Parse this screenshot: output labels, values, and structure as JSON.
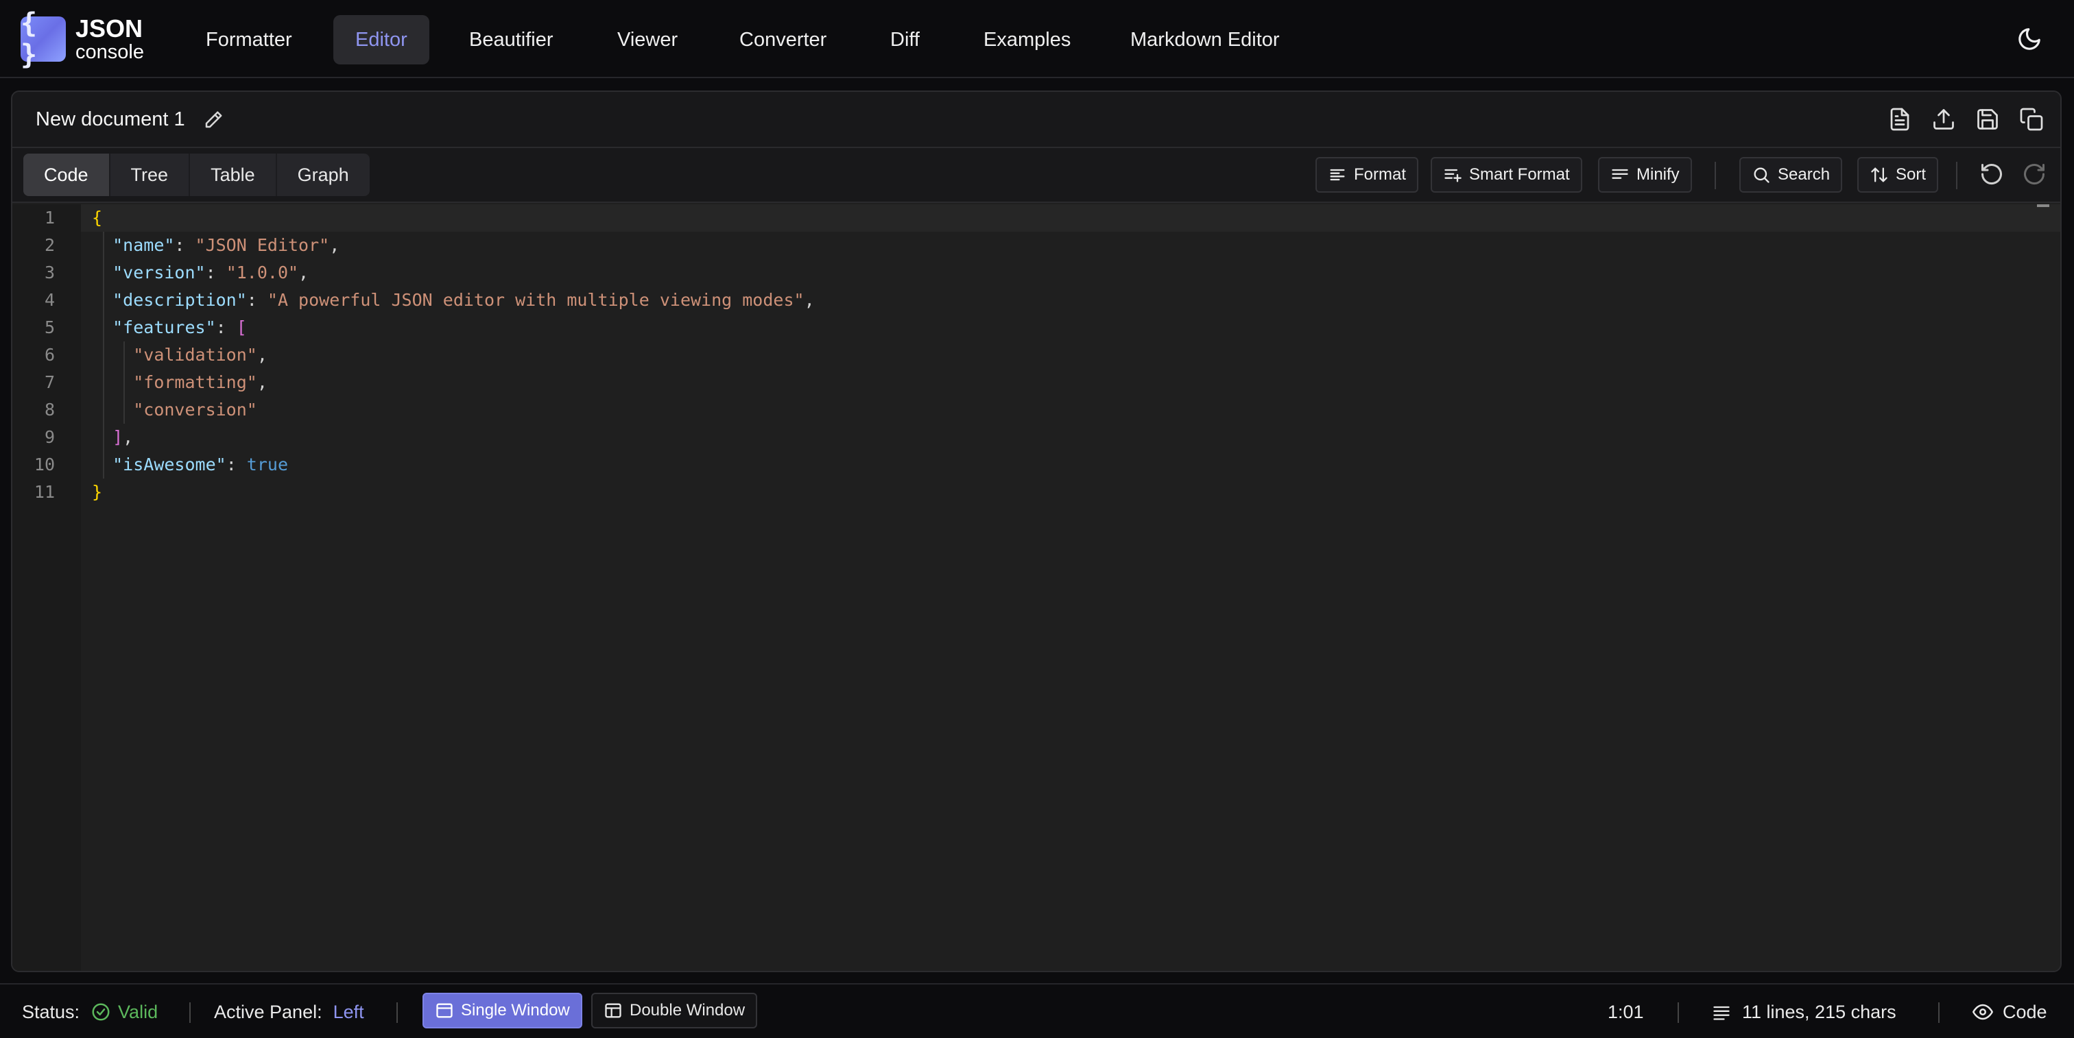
{
  "app": {
    "logo_mark": "{ }",
    "logo_line1": "JSON",
    "logo_line2": "console"
  },
  "nav": {
    "items": [
      {
        "label": "Formatter",
        "active": false
      },
      {
        "label": "Editor",
        "active": true
      },
      {
        "label": "Beautifier",
        "active": false
      },
      {
        "label": "Viewer",
        "active": false
      },
      {
        "label": "Converter",
        "active": false
      },
      {
        "label": "Diff",
        "active": false
      },
      {
        "label": "Examples",
        "active": false
      },
      {
        "label": "Markdown Editor",
        "active": false
      }
    ],
    "theme_icon": "moon-icon"
  },
  "document": {
    "title": "New document 1",
    "header_icons": [
      "file-icon",
      "upload-icon",
      "save-icon",
      "copy-icon"
    ]
  },
  "toolbar": {
    "tabs": [
      {
        "label": "Code",
        "active": true
      },
      {
        "label": "Tree",
        "active": false
      },
      {
        "label": "Table",
        "active": false
      },
      {
        "label": "Graph",
        "active": false
      }
    ],
    "format_label": "Format",
    "smart_format_label": "Smart Format",
    "minify_label": "Minify",
    "search_label": "Search",
    "sort_label": "Sort"
  },
  "editor": {
    "line_numbers": [
      "1",
      "2",
      "3",
      "4",
      "5",
      "6",
      "7",
      "8",
      "9",
      "10",
      "11"
    ],
    "lines": [
      [
        {
          "t": "b1",
          "v": "{"
        }
      ],
      [
        {
          "t": "p",
          "v": "  "
        },
        {
          "t": "k",
          "v": "\"name\""
        },
        {
          "t": "p",
          "v": ": "
        },
        {
          "t": "s",
          "v": "\"JSON Editor\""
        },
        {
          "t": "p",
          "v": ","
        }
      ],
      [
        {
          "t": "p",
          "v": "  "
        },
        {
          "t": "k",
          "v": "\"version\""
        },
        {
          "t": "p",
          "v": ": "
        },
        {
          "t": "s",
          "v": "\"1.0.0\""
        },
        {
          "t": "p",
          "v": ","
        }
      ],
      [
        {
          "t": "p",
          "v": "  "
        },
        {
          "t": "k",
          "v": "\"description\""
        },
        {
          "t": "p",
          "v": ": "
        },
        {
          "t": "s",
          "v": "\"A powerful JSON editor with multiple viewing modes\""
        },
        {
          "t": "p",
          "v": ","
        }
      ],
      [
        {
          "t": "p",
          "v": "  "
        },
        {
          "t": "k",
          "v": "\"features\""
        },
        {
          "t": "p",
          "v": ": "
        },
        {
          "t": "b2",
          "v": "["
        }
      ],
      [
        {
          "t": "p",
          "v": "    "
        },
        {
          "t": "s",
          "v": "\"validation\""
        },
        {
          "t": "p",
          "v": ","
        }
      ],
      [
        {
          "t": "p",
          "v": "    "
        },
        {
          "t": "s",
          "v": "\"formatting\""
        },
        {
          "t": "p",
          "v": ","
        }
      ],
      [
        {
          "t": "p",
          "v": "    "
        },
        {
          "t": "s",
          "v": "\"conversion\""
        }
      ],
      [
        {
          "t": "p",
          "v": "  "
        },
        {
          "t": "b2",
          "v": "]"
        },
        {
          "t": "p",
          "v": ","
        }
      ],
      [
        {
          "t": "p",
          "v": "  "
        },
        {
          "t": "k",
          "v": "\"isAwesome\""
        },
        {
          "t": "p",
          "v": ": "
        },
        {
          "t": "kw",
          "v": "true"
        }
      ],
      [
        {
          "t": "b1",
          "v": "}"
        }
      ]
    ]
  },
  "status": {
    "status_label": "Status:",
    "status_value": "Valid",
    "active_panel_label": "Active Panel:",
    "active_panel_value": "Left",
    "single_window_label": "Single Window",
    "double_window_label": "Double Window",
    "cursor_position": "1:01",
    "stats": "11 lines, 215 chars",
    "mode_label": "Code"
  }
}
